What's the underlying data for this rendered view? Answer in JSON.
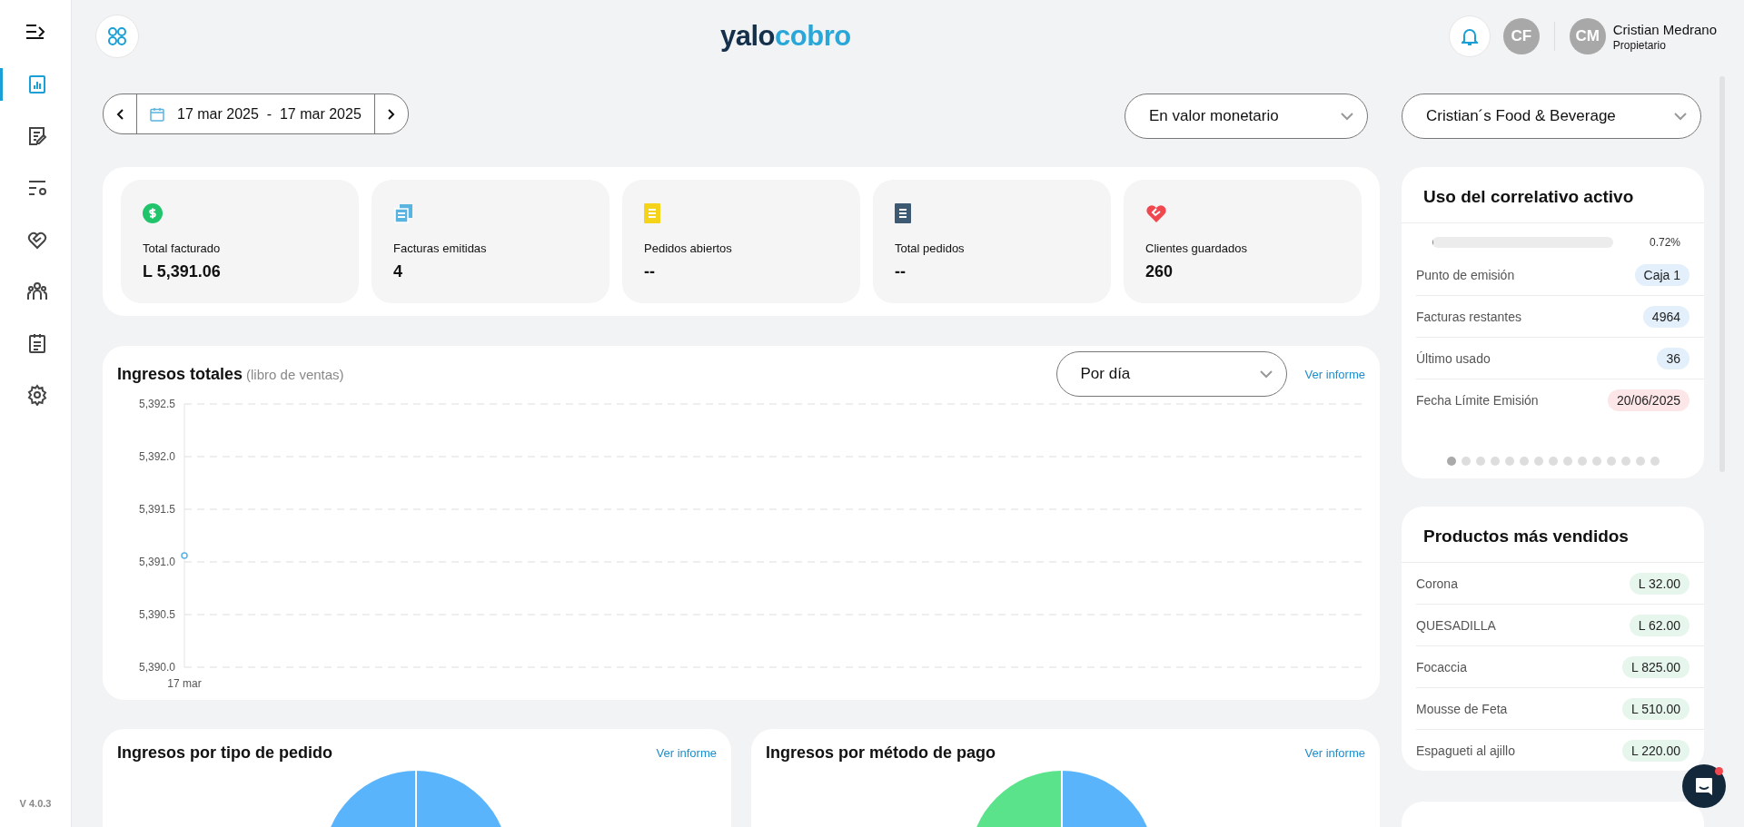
{
  "sidebar": {
    "items": [
      {
        "selected": true
      },
      {
        "selected": false
      },
      {
        "selected": false
      },
      {
        "selected": false
      },
      {
        "selected": false
      },
      {
        "selected": false
      },
      {
        "selected": false
      }
    ],
    "version": "V 4.0.3"
  },
  "header": {
    "logo": {
      "text": "yalo",
      "accent": "cobro"
    },
    "avatars": [
      {
        "initials": "CF"
      },
      {
        "initials": "CM"
      }
    ],
    "user": {
      "name": "Cristian Medrano",
      "role": "Propietario"
    }
  },
  "toolbar": {
    "date_range": "17 mar 2025  -  17 mar 2025",
    "view": "En valor monetario",
    "company": "Cristian´s Food & Beverage"
  },
  "kpis": [
    {
      "label": "Total facturado",
      "value": "L 5,391.06"
    },
    {
      "label": "Facturas emitidas",
      "value": "4"
    },
    {
      "label": "Pedidos abiertos",
      "value": "--"
    },
    {
      "label": "Total pedidos",
      "value": "--"
    },
    {
      "label": "Clientes guardados",
      "value": "260"
    }
  ],
  "revenue": {
    "title": "Ingresos totales",
    "subtitle": "(libro de ventas)",
    "period": "Por día",
    "link": "Ver informe",
    "chart_data": {
      "type": "line",
      "grid": true,
      "categories": [
        "17 mar"
      ],
      "series": [
        {
          "color": "#5ab4e5",
          "marker": true,
          "values": [
            5391.06
          ]
        }
      ],
      "ylim": [
        5390,
        5392.5
      ],
      "yticks": [
        {
          "value": 5392.5,
          "label": "5,392.5"
        },
        {
          "value": 5392,
          "label": "5,392.0"
        },
        {
          "value": 5391.5,
          "label": "5,391.5"
        },
        {
          "value": 5391,
          "label": "5,391.0"
        },
        {
          "value": 5390.5,
          "label": "5,390.5"
        },
        {
          "value": 5390,
          "label": "5,390.0"
        }
      ]
    }
  },
  "bottom_cards": [
    {
      "title": "Ingresos por tipo de pedido",
      "link": "Ver informe"
    },
    {
      "title": "Ingresos por método de pago",
      "link": "Ver informe"
    }
  ],
  "correlative": {
    "title": "Uso del correlativo activo",
    "level": 0.0072,
    "reading": "0.72%",
    "rows": [
      {
        "label": "Punto de emisión",
        "value": "Caja 1",
        "color": "#e3f0fc"
      },
      {
        "label": "Facturas restantes",
        "value": "4964",
        "color": "#e3f0fc"
      },
      {
        "label": "Último usado",
        "value": "36",
        "color": "#e3f0fc"
      },
      {
        "label": "Fecha Límite Emisión",
        "value": "20/06/2025",
        "color": "#fde6e8"
      }
    ],
    "pager": [
      {
        "selected": true
      },
      {
        "selected": false
      },
      {
        "selected": false
      },
      {
        "selected": false
      },
      {
        "selected": false
      },
      {
        "selected": false
      },
      {
        "selected": false
      },
      {
        "selected": false
      },
      {
        "selected": false
      },
      {
        "selected": false
      },
      {
        "selected": false
      },
      {
        "selected": false
      },
      {
        "selected": false
      },
      {
        "selected": false
      },
      {
        "selected": false
      }
    ]
  },
  "top_products": {
    "title": "Productos más vendidos",
    "rows": [
      {
        "name": "Corona",
        "amount": "L 32.00"
      },
      {
        "name": "QUESADILLA",
        "amount": "L 62.00"
      },
      {
        "name": "Focaccia",
        "amount": "L 825.00"
      },
      {
        "name": "Mousse de Feta",
        "amount": "L 510.00"
      },
      {
        "name": "Espagueti al ajillo",
        "amount": "L 220.00"
      }
    ]
  },
  "chat": {
    "unread": true
  }
}
